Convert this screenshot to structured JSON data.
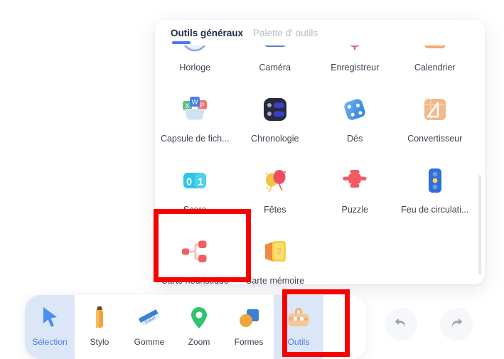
{
  "panel": {
    "tabs": [
      {
        "label": "Outils généraux",
        "active": true
      },
      {
        "label": "Palette d'  outils",
        "active": false
      }
    ],
    "settings_icon": "gear-icon",
    "scrollbar": "vertical-scrollbar",
    "tools": [
      {
        "label": "Horloge",
        "icon": "clock-icon"
      },
      {
        "label": "Caméra",
        "icon": "camera-icon"
      },
      {
        "label": "Enregistreur",
        "icon": "recorder-icon"
      },
      {
        "label": "Calendrier",
        "icon": "calendar-icon"
      },
      {
        "label": "Capsule de fich...",
        "icon": "file-capsule-icon"
      },
      {
        "label": "Chronologie",
        "icon": "timeline-icon"
      },
      {
        "label": "Dés",
        "icon": "dice-icon"
      },
      {
        "label": "Convertisseur",
        "icon": "converter-icon"
      },
      {
        "label": "Score",
        "icon": "score-icon"
      },
      {
        "label": "Fêtes",
        "icon": "balloons-icon"
      },
      {
        "label": "Puzzle",
        "icon": "puzzle-icon"
      },
      {
        "label": "Feu de circulati...",
        "icon": "traffic-light-icon"
      },
      {
        "label": "Carte heuristique",
        "icon": "mind-map-icon"
      },
      {
        "label": "Carte mémoire",
        "icon": "flashcard-icon"
      }
    ]
  },
  "toolbar": {
    "items": [
      {
        "label": "Sélection",
        "icon": "cursor-icon",
        "selected": true
      },
      {
        "label": "Stylo",
        "icon": "pencil-icon",
        "selected": false
      },
      {
        "label": "Gomme",
        "icon": "eraser-icon",
        "selected": false
      },
      {
        "label": "Zoom",
        "icon": "pin-icon",
        "selected": false
      },
      {
        "label": "Formes",
        "icon": "shapes-icon",
        "selected": false
      },
      {
        "label": "Outils",
        "icon": "toolbox-icon",
        "selected": true
      }
    ],
    "undo": "undo-arrow-icon",
    "redo": "redo-arrow-icon"
  },
  "annotations": [
    {
      "name": "highlight-carte-heuristique",
      "target": "Carte heuristique",
      "color": "#f70000"
    },
    {
      "name": "highlight-outils",
      "target": "Outils",
      "color": "#f70000"
    }
  ],
  "colors": {
    "accent": "#4a7cf0",
    "selected_bg": "#dbe7f7",
    "annotation": "#f70000",
    "panel_bg": "#ffffff",
    "text": "#3c4250",
    "muted_text": "#b7bcc9"
  }
}
